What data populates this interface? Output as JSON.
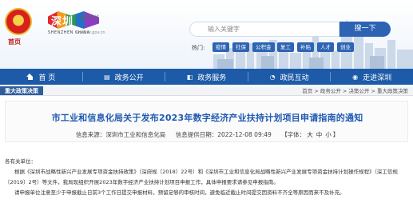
{
  "header": {
    "emblem_label": "首页",
    "logo_cn": "深圳",
    "logo_sub": "政府在线",
    "logo_en": "SHENZHEN CHINA",
    "logo_url": "www.sz.gov.cn",
    "search_placeholder": "输入关键字",
    "search_button": "搜一下",
    "hot_label": "热门:",
    "hot_tags": [
      "疫情",
      "社保",
      "公积金",
      "复工",
      "补贴",
      "人才",
      "创业"
    ]
  },
  "nav": {
    "items": [
      {
        "label": "首 页",
        "icon": "home-icon"
      },
      {
        "label": "政务公开",
        "icon": "document-icon"
      },
      {
        "label": "政务服务",
        "icon": "service-icon"
      },
      {
        "label": "政民互动",
        "icon": "chat-icon"
      },
      {
        "label": "走进深圳",
        "icon": "globe-icon"
      }
    ]
  },
  "breadcrumb": {
    "main": "重大政策决策",
    "path": "首页 > 政务公开 > 决策公开 > 重大政策决策"
  },
  "article": {
    "title": "市工业和信息化局关于发布2023年数字经济产业扶持计划项目申请指南的通知",
    "source_label": "信息来源：",
    "source": "深圳市工业和信息化局",
    "date_label": "信息提供日期：",
    "date": "2022-12-08 09:49",
    "font_label": "【字体：",
    "font_large": "大",
    "font_medium": "中",
    "font_small": "小",
    "font_close": "】",
    "salutation": "各有关单位：",
    "para1": "根据《深圳市战略性新兴产业发展专项资金扶持政策》（深府规〔2018〕22号）和《深圳市工业和信息化局战略性新兴产业发展专项资金扶持计划操作规程》（深工信规〔2019〕2号）等文件，我局现组织开展2023年数字经济产业扶持计划项目申报工作，具体申报要求请参见申报指南。",
    "para2": "请申报单位注意至少于申报截止日前3个工作日提交申报材料，预留足够的审核时间，避免临近截止时间提交因资料不齐全等原因而来不及补充。"
  }
}
